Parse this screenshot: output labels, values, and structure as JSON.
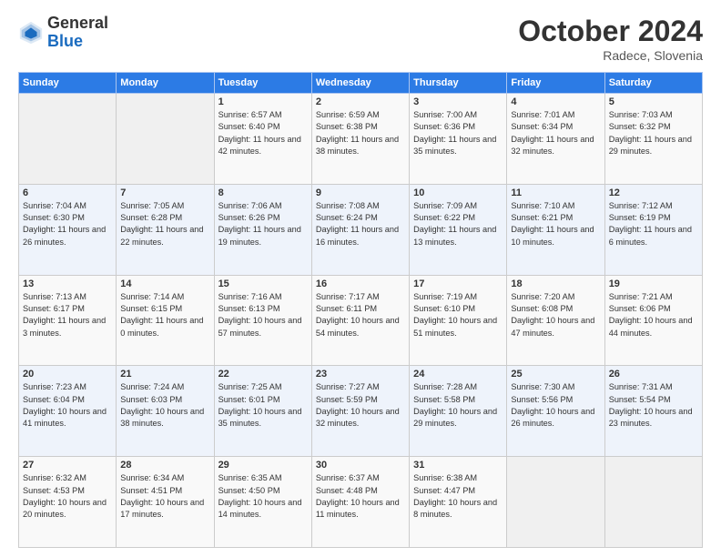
{
  "logo": {
    "general": "General",
    "blue": "Blue"
  },
  "title": "October 2024",
  "subtitle": "Radece, Slovenia",
  "days_header": [
    "Sunday",
    "Monday",
    "Tuesday",
    "Wednesday",
    "Thursday",
    "Friday",
    "Saturday"
  ],
  "weeks": [
    [
      {
        "day": "",
        "info": ""
      },
      {
        "day": "",
        "info": ""
      },
      {
        "day": "1",
        "info": "Sunrise: 6:57 AM\nSunset: 6:40 PM\nDaylight: 11 hours and 42 minutes."
      },
      {
        "day": "2",
        "info": "Sunrise: 6:59 AM\nSunset: 6:38 PM\nDaylight: 11 hours and 38 minutes."
      },
      {
        "day": "3",
        "info": "Sunrise: 7:00 AM\nSunset: 6:36 PM\nDaylight: 11 hours and 35 minutes."
      },
      {
        "day": "4",
        "info": "Sunrise: 7:01 AM\nSunset: 6:34 PM\nDaylight: 11 hours and 32 minutes."
      },
      {
        "day": "5",
        "info": "Sunrise: 7:03 AM\nSunset: 6:32 PM\nDaylight: 11 hours and 29 minutes."
      }
    ],
    [
      {
        "day": "6",
        "info": "Sunrise: 7:04 AM\nSunset: 6:30 PM\nDaylight: 11 hours and 26 minutes."
      },
      {
        "day": "7",
        "info": "Sunrise: 7:05 AM\nSunset: 6:28 PM\nDaylight: 11 hours and 22 minutes."
      },
      {
        "day": "8",
        "info": "Sunrise: 7:06 AM\nSunset: 6:26 PM\nDaylight: 11 hours and 19 minutes."
      },
      {
        "day": "9",
        "info": "Sunrise: 7:08 AM\nSunset: 6:24 PM\nDaylight: 11 hours and 16 minutes."
      },
      {
        "day": "10",
        "info": "Sunrise: 7:09 AM\nSunset: 6:22 PM\nDaylight: 11 hours and 13 minutes."
      },
      {
        "day": "11",
        "info": "Sunrise: 7:10 AM\nSunset: 6:21 PM\nDaylight: 11 hours and 10 minutes."
      },
      {
        "day": "12",
        "info": "Sunrise: 7:12 AM\nSunset: 6:19 PM\nDaylight: 11 hours and 6 minutes."
      }
    ],
    [
      {
        "day": "13",
        "info": "Sunrise: 7:13 AM\nSunset: 6:17 PM\nDaylight: 11 hours and 3 minutes."
      },
      {
        "day": "14",
        "info": "Sunrise: 7:14 AM\nSunset: 6:15 PM\nDaylight: 11 hours and 0 minutes."
      },
      {
        "day": "15",
        "info": "Sunrise: 7:16 AM\nSunset: 6:13 PM\nDaylight: 10 hours and 57 minutes."
      },
      {
        "day": "16",
        "info": "Sunrise: 7:17 AM\nSunset: 6:11 PM\nDaylight: 10 hours and 54 minutes."
      },
      {
        "day": "17",
        "info": "Sunrise: 7:19 AM\nSunset: 6:10 PM\nDaylight: 10 hours and 51 minutes."
      },
      {
        "day": "18",
        "info": "Sunrise: 7:20 AM\nSunset: 6:08 PM\nDaylight: 10 hours and 47 minutes."
      },
      {
        "day": "19",
        "info": "Sunrise: 7:21 AM\nSunset: 6:06 PM\nDaylight: 10 hours and 44 minutes."
      }
    ],
    [
      {
        "day": "20",
        "info": "Sunrise: 7:23 AM\nSunset: 6:04 PM\nDaylight: 10 hours and 41 minutes."
      },
      {
        "day": "21",
        "info": "Sunrise: 7:24 AM\nSunset: 6:03 PM\nDaylight: 10 hours and 38 minutes."
      },
      {
        "day": "22",
        "info": "Sunrise: 7:25 AM\nSunset: 6:01 PM\nDaylight: 10 hours and 35 minutes."
      },
      {
        "day": "23",
        "info": "Sunrise: 7:27 AM\nSunset: 5:59 PM\nDaylight: 10 hours and 32 minutes."
      },
      {
        "day": "24",
        "info": "Sunrise: 7:28 AM\nSunset: 5:58 PM\nDaylight: 10 hours and 29 minutes."
      },
      {
        "day": "25",
        "info": "Sunrise: 7:30 AM\nSunset: 5:56 PM\nDaylight: 10 hours and 26 minutes."
      },
      {
        "day": "26",
        "info": "Sunrise: 7:31 AM\nSunset: 5:54 PM\nDaylight: 10 hours and 23 minutes."
      }
    ],
    [
      {
        "day": "27",
        "info": "Sunrise: 6:32 AM\nSunset: 4:53 PM\nDaylight: 10 hours and 20 minutes."
      },
      {
        "day": "28",
        "info": "Sunrise: 6:34 AM\nSunset: 4:51 PM\nDaylight: 10 hours and 17 minutes."
      },
      {
        "day": "29",
        "info": "Sunrise: 6:35 AM\nSunset: 4:50 PM\nDaylight: 10 hours and 14 minutes."
      },
      {
        "day": "30",
        "info": "Sunrise: 6:37 AM\nSunset: 4:48 PM\nDaylight: 10 hours and 11 minutes."
      },
      {
        "day": "31",
        "info": "Sunrise: 6:38 AM\nSunset: 4:47 PM\nDaylight: 10 hours and 8 minutes."
      },
      {
        "day": "",
        "info": ""
      },
      {
        "day": "",
        "info": ""
      }
    ]
  ]
}
